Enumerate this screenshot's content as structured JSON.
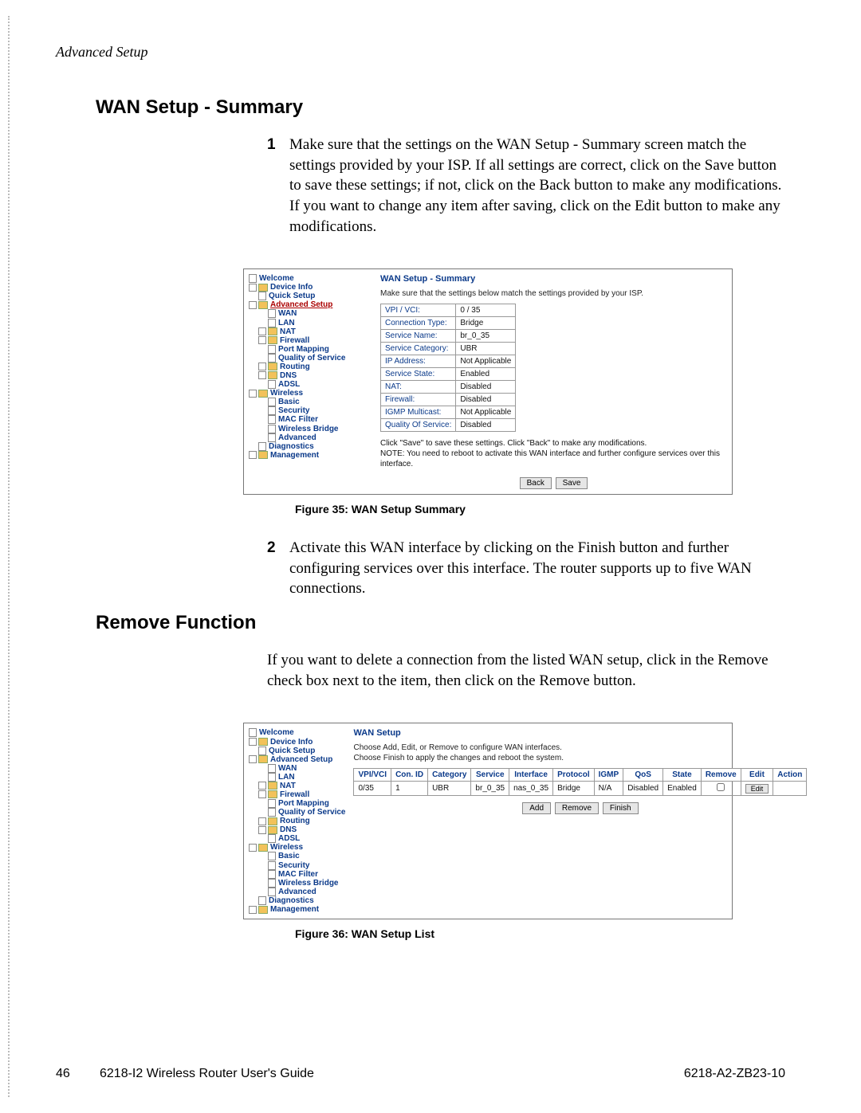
{
  "header": {
    "breadcrumb": "Advanced Setup"
  },
  "sections": [
    {
      "title": "WAN Setup - Summary",
      "steps": [
        {
          "num": "1",
          "text": "Make sure that the settings on the WAN Setup - Summary screen match the settings provided by your ISP. If all settings are correct, click on the Save button to save these settings; if not, click on the Back button to make any modifications. If you want to change any item after saving, click on the Edit button to make any modifications."
        },
        {
          "num": "2",
          "text": "Activate this WAN interface by clicking on the Finish button and further configuring services over this interface. The router supports up to five WAN connections."
        }
      ]
    },
    {
      "title": "Remove Function",
      "text": "If you want to delete a connection from the listed WAN setup, click in the Remove check box next to the item, then click on the Remove button."
    }
  ],
  "fig35": {
    "nav": [
      "Welcome",
      "Device Info",
      "Quick Setup",
      "Advanced Setup",
      "WAN",
      "LAN",
      "NAT",
      "Firewall",
      "Port Mapping",
      "Quality of Service",
      "Routing",
      "DNS",
      "ADSL",
      "Wireless",
      "Basic",
      "Security",
      "MAC Filter",
      "Wireless Bridge",
      "Advanced",
      "Diagnostics",
      "Management"
    ],
    "panel_title": "WAN Setup - Summary",
    "panel_sub": "Make sure that the settings below match the settings provided by your ISP.",
    "rows": [
      {
        "k": "VPI / VCI:",
        "v": "0 / 35"
      },
      {
        "k": "Connection Type:",
        "v": "Bridge"
      },
      {
        "k": "Service Name:",
        "v": "br_0_35"
      },
      {
        "k": "Service Category:",
        "v": "UBR"
      },
      {
        "k": "IP Address:",
        "v": "Not Applicable"
      },
      {
        "k": "Service State:",
        "v": "Enabled"
      },
      {
        "k": "NAT:",
        "v": "Disabled"
      },
      {
        "k": "Firewall:",
        "v": "Disabled"
      },
      {
        "k": "IGMP Multicast:",
        "v": "Not Applicable"
      },
      {
        "k": "Quality Of Service:",
        "v": "Disabled"
      }
    ],
    "note1": "Click \"Save\" to save these settings. Click \"Back\" to make any modifications.",
    "note2": "NOTE: You need to reboot to activate this WAN interface and further configure services over this interface.",
    "buttons": {
      "back": "Back",
      "save": "Save"
    },
    "caption": "Figure 35: WAN Setup Summary"
  },
  "fig36": {
    "nav": [
      "Welcome",
      "Device Info",
      "Quick Setup",
      "Advanced Setup",
      "WAN",
      "LAN",
      "NAT",
      "Firewall",
      "Port Mapping",
      "Quality of Service",
      "Routing",
      "DNS",
      "ADSL",
      "Wireless",
      "Basic",
      "Security",
      "MAC Filter",
      "Wireless Bridge",
      "Advanced",
      "Diagnostics",
      "Management"
    ],
    "panel_title": "WAN Setup",
    "panel_sub1": "Choose Add, Edit, or Remove to configure WAN interfaces.",
    "panel_sub2": "Choose Finish to apply the changes and reboot the system.",
    "headers": [
      "VPI/VCI",
      "Con. ID",
      "Category",
      "Service",
      "Interface",
      "Protocol",
      "IGMP",
      "QoS",
      "State",
      "Remove",
      "Edit",
      "Action"
    ],
    "row": [
      "0/35",
      "1",
      "UBR",
      "br_0_35",
      "nas_0_35",
      "Bridge",
      "N/A",
      "Disabled",
      "Enabled"
    ],
    "row_edit": "Edit",
    "buttons": {
      "add": "Add",
      "remove": "Remove",
      "finish": "Finish"
    },
    "caption": "Figure 36: WAN Setup List"
  },
  "footer": {
    "page": "46",
    "title": "6218-I2 Wireless Router User's Guide",
    "code": "6218-A2-ZB23-10"
  }
}
